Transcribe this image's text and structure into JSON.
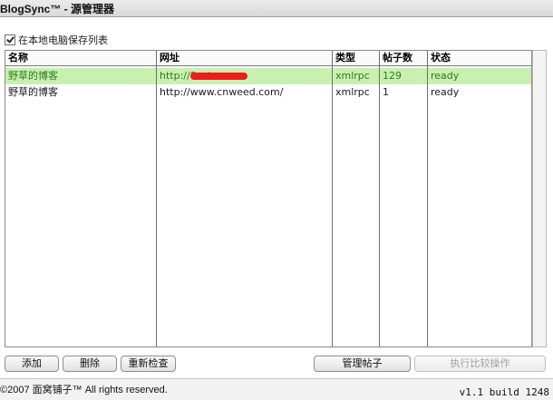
{
  "window": {
    "title": "BlogSync™ - 源管理器"
  },
  "options": {
    "save_local_label": "在本地电脑保存列表",
    "save_local_checked": true
  },
  "table": {
    "columns": [
      "名称",
      "网址",
      "类型",
      "帖子数",
      "状态"
    ],
    "rows": [
      {
        "name": "野草的博客",
        "url": "http://8                     a/",
        "url_redacted": true,
        "type": "xmlrpc",
        "posts": "129",
        "status": "ready",
        "selected": true
      },
      {
        "name": "野草的博客",
        "url": "http://www.cnweed.com/",
        "type": "xmlrpc",
        "posts": "1",
        "status": "ready",
        "selected": false
      }
    ]
  },
  "buttons": {
    "add": "添加",
    "delete": "删除",
    "recheck": "重新检查",
    "manage_posts": "管理帖子",
    "run_compare": "执行比较操作"
  },
  "footer": {
    "copyright": "©2007 面窝铺子™ All rights reserved.",
    "version": "v1.1 build 1248"
  },
  "colors": {
    "selected_row_bg": "#c8f0b0",
    "selected_text": "#2d7a1e",
    "redaction": "#ee1c1c"
  }
}
